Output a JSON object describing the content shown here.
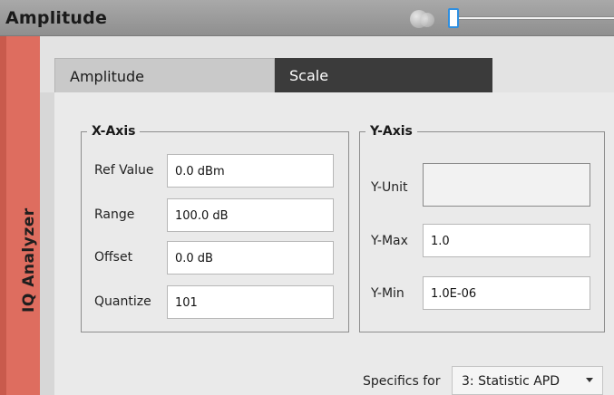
{
  "window": {
    "title": "Amplitude"
  },
  "sidebar": {
    "label": "IQ Analyzer"
  },
  "tabs": [
    {
      "label": "Amplitude",
      "active": false
    },
    {
      "label": "Scale",
      "active": true
    }
  ],
  "x_axis": {
    "title": "X-Axis",
    "fields": {
      "ref_value": {
        "label": "Ref Value",
        "value": "0.0 dBm"
      },
      "range": {
        "label": "Range",
        "value": "100.0 dB"
      },
      "offset": {
        "label": "Offset",
        "value": "0.0 dB"
      },
      "quantize": {
        "label": "Quantize",
        "value": "101"
      }
    }
  },
  "y_axis": {
    "title": "Y-Axis",
    "fields": {
      "y_unit": {
        "label": "Y-Unit",
        "value": ""
      },
      "y_max": {
        "label": "Y-Max",
        "value": "1.0"
      },
      "y_min": {
        "label": "Y-Min",
        "value": "1.0E-06"
      }
    }
  },
  "specifics": {
    "label": "Specifics for",
    "selected": "3: Statistic APD"
  },
  "colors": {
    "accent_sidebar": "#de6d5f",
    "active_tab": "#3b3b3b",
    "slider_accent": "#2f8fe0"
  }
}
